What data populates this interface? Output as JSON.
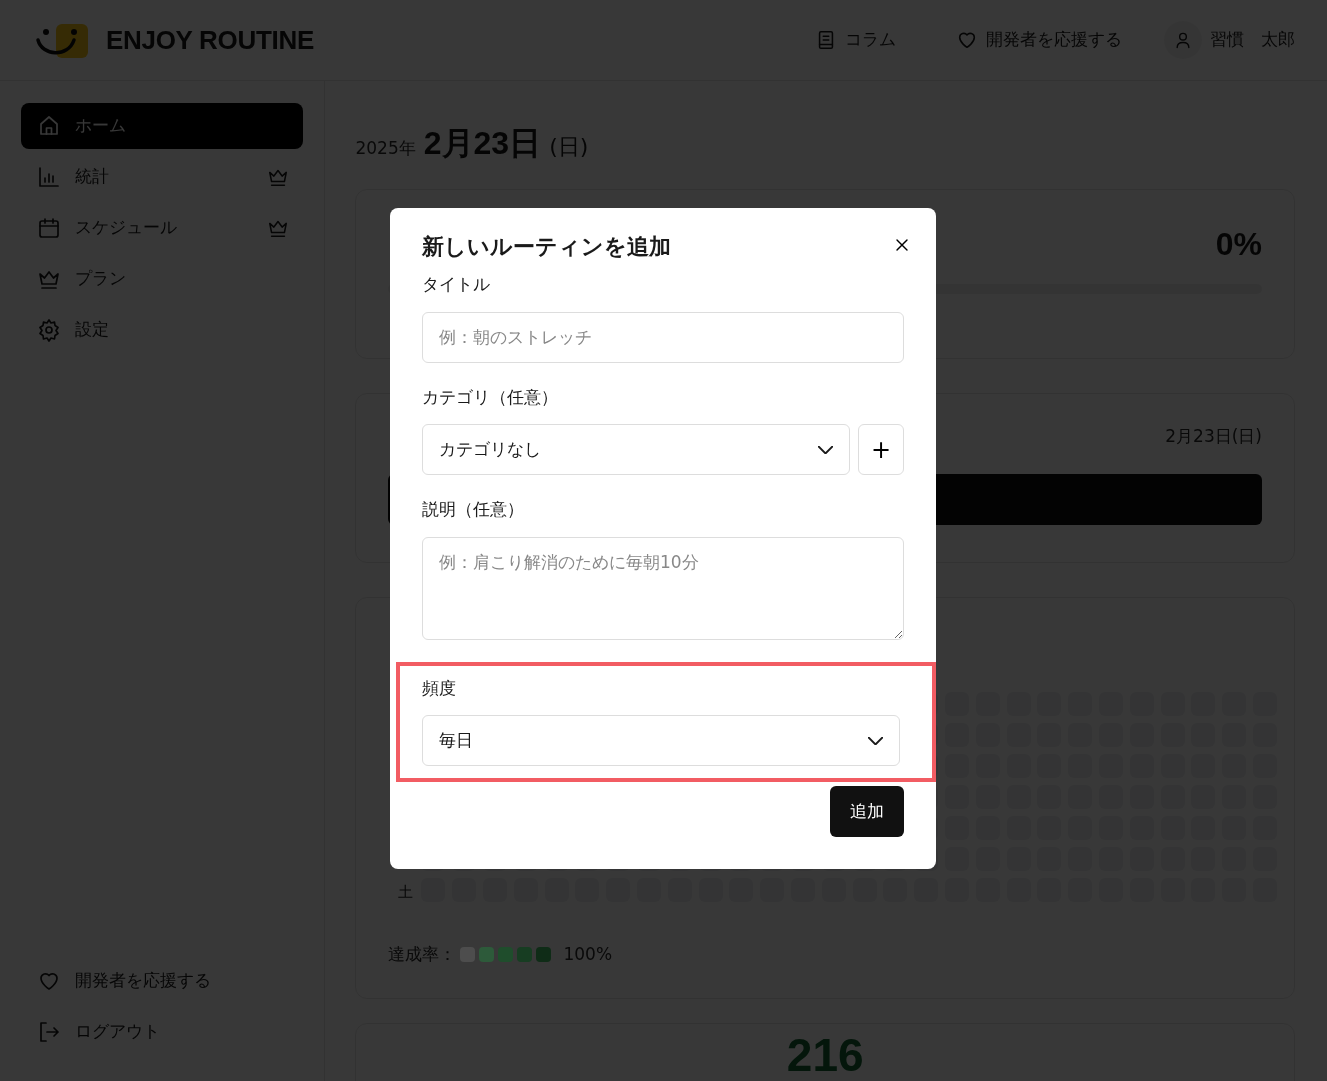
{
  "header": {
    "logo_text": "ENJOY ROUTINE",
    "nav": [
      {
        "kind": "book",
        "label": "コラム"
      },
      {
        "kind": "heart",
        "label": "開発者を応援する"
      }
    ],
    "user": {
      "name": "習慣　太郎"
    }
  },
  "sidebar": {
    "items": [
      {
        "label": "ホーム",
        "selected": true,
        "premium": false
      },
      {
        "label": "統計",
        "selected": false,
        "premium": true
      },
      {
        "label": "スケジュール",
        "selected": false,
        "premium": true
      },
      {
        "label": "プラン",
        "selected": false,
        "premium": false
      },
      {
        "label": "設定",
        "selected": false,
        "premium": false
      }
    ],
    "footer_items": [
      {
        "label": "開発者を応援する"
      },
      {
        "label": "ログアウト"
      }
    ]
  },
  "main": {
    "date": {
      "year": "2025年",
      "day": "2月23日",
      "weekday": "(日)"
    },
    "progress_card": {
      "percent": "0%",
      "level": 0
    },
    "today_card": {
      "date": "2月23日(日)"
    },
    "heatmap_card": {
      "row_label": "土",
      "legend_label": "達成率：",
      "legend_swatches": [
        {
          "color": "#4d4d4d"
        },
        {
          "color": "#2d5a3a"
        },
        {
          "color": "#1f4d2c"
        },
        {
          "color": "#173d22"
        },
        {
          "color": "#0f2c17"
        }
      ],
      "legend_max": "100%"
    },
    "stats_card": {
      "value": "216"
    }
  },
  "modal": {
    "title": "新しいルーティンを追加",
    "fields": [
      {
        "kind": "text",
        "label": "タイトル",
        "placeholder": "例：朝のストレッチ",
        "highlighted": false
      },
      {
        "kind": "select",
        "label": "カテゴリ（任意）",
        "value": "カテゴリなし",
        "add_button": "+",
        "highlighted": false
      },
      {
        "kind": "textarea",
        "label": "説明（任意）",
        "placeholder": "例：肩こり解消のために毎朝10分",
        "highlighted": false
      },
      {
        "kind": "select",
        "label": "頻度",
        "value": "毎日",
        "highlighted": true
      }
    ],
    "submit": "追加"
  }
}
